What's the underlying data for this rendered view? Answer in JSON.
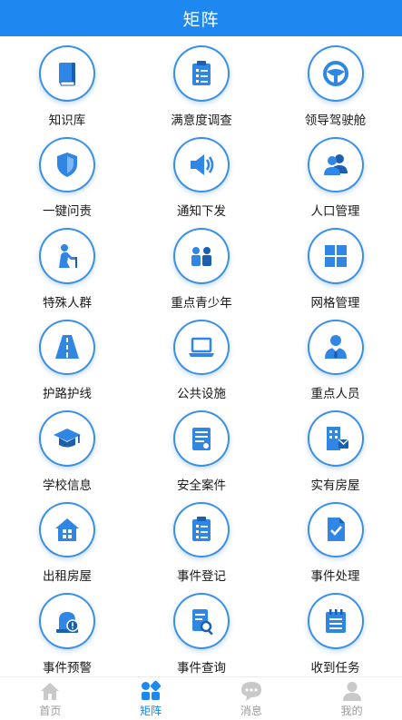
{
  "header": {
    "title": "矩阵"
  },
  "colors": {
    "accent": "#1e88f0",
    "icon_blue": "#2f86e4",
    "tab_inactive": "#c9c9c9"
  },
  "grid": {
    "items": [
      {
        "label": "知识库",
        "icon": "book-icon"
      },
      {
        "label": "满意度调查",
        "icon": "clipboard-survey-icon"
      },
      {
        "label": "领导驾驶舱",
        "icon": "steering-wheel-icon"
      },
      {
        "label": "一键问责",
        "icon": "shield-icon"
      },
      {
        "label": "通知下发",
        "icon": "speaker-icon"
      },
      {
        "label": "人口管理",
        "icon": "people-icon"
      },
      {
        "label": "特殊人群",
        "icon": "elderly-person-icon"
      },
      {
        "label": "重点青少年",
        "icon": "youth-icon"
      },
      {
        "label": "网格管理",
        "icon": "grid-icon"
      },
      {
        "label": "护路护线",
        "icon": "road-icon"
      },
      {
        "label": "公共设施",
        "icon": "laptop-icon"
      },
      {
        "label": "重点人员",
        "icon": "person-tie-icon"
      },
      {
        "label": "学校信息",
        "icon": "graduation-cap-icon"
      },
      {
        "label": "安全案件",
        "icon": "case-document-icon"
      },
      {
        "label": "实有房屋",
        "icon": "building-icon"
      },
      {
        "label": "出租房屋",
        "icon": "house-icon"
      },
      {
        "label": "事件登记",
        "icon": "register-clipboard-icon"
      },
      {
        "label": "事件处理",
        "icon": "check-document-icon"
      },
      {
        "label": "事件预警",
        "icon": "alarm-icon"
      },
      {
        "label": "事件查询",
        "icon": "search-document-icon"
      },
      {
        "label": "收到任务",
        "icon": "task-calendar-icon"
      }
    ]
  },
  "tabbar": {
    "tabs": [
      {
        "label": "首页",
        "icon": "home-icon"
      },
      {
        "label": "矩阵",
        "icon": "matrix-icon"
      },
      {
        "label": "消息",
        "icon": "message-icon"
      },
      {
        "label": "我的",
        "icon": "user-icon"
      }
    ]
  }
}
